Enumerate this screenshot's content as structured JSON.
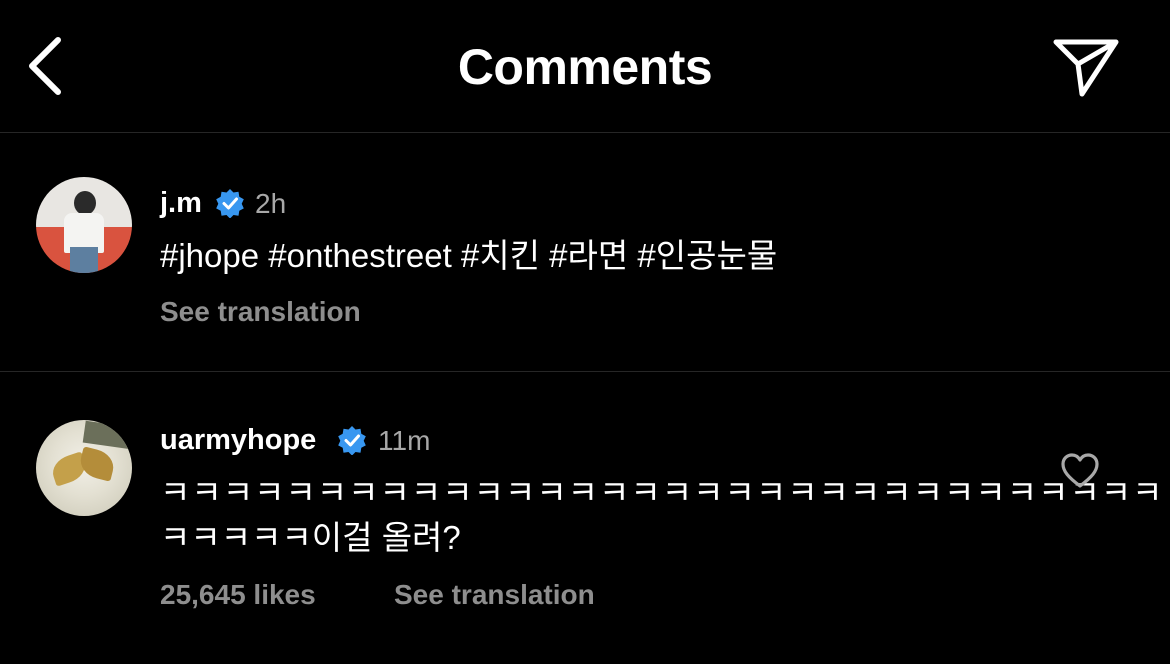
{
  "header": {
    "title": "Comments",
    "back_icon": "chevron-left-icon",
    "share_icon": "paper-plane-icon"
  },
  "caption": {
    "username": "j.m",
    "verified": true,
    "time": "2h",
    "text": "#jhope #onthestreet #치킨 #라면 #인공눈물",
    "see_translation": "See translation"
  },
  "comments": [
    {
      "username": "uarmyhope",
      "verified": true,
      "time": "11m",
      "text_line1": "ㅋㅋㅋㅋㅋㅋㅋㅋㅋㅋㅋㅋㅋㅋㅋㅋㅋㅋㅋㅋㅋㅋㅋㅋㅋㅋㅋㅋㅋㅋㅋㅋ",
      "text_line2": "ㅋㅋㅋㅋㅋ이걸 올려?",
      "likes": "25,645 likes",
      "see_translation": "See translation",
      "like_icon": "heart-outline-icon"
    }
  ],
  "colors": {
    "background": "#000000",
    "verified_badge": "#3897f0",
    "secondary_text": "#a8a8a8",
    "divider": "#262626"
  }
}
